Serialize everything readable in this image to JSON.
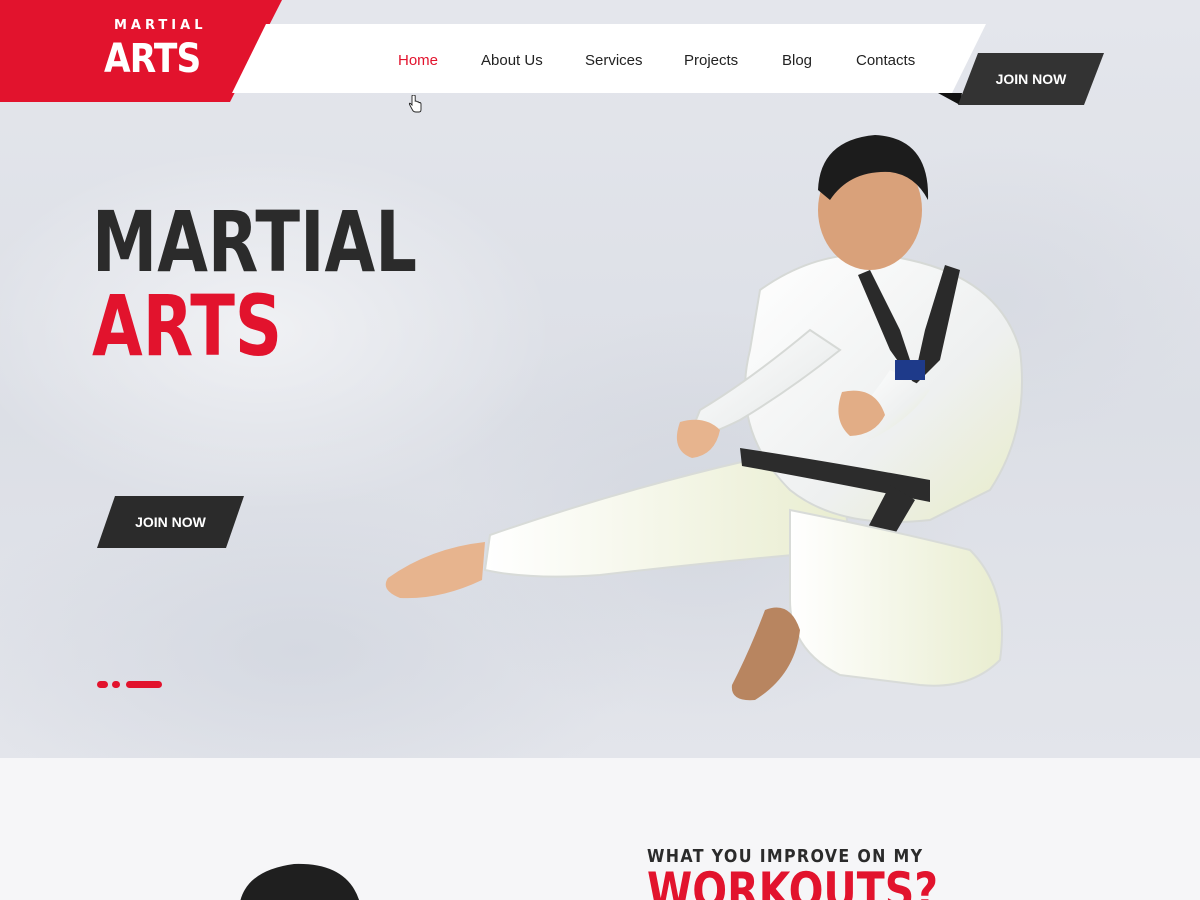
{
  "logo": {
    "top_text": "MARTIAL",
    "main_text": "ARTS"
  },
  "nav": {
    "items": [
      {
        "label": "Home",
        "active": true
      },
      {
        "label": "About Us",
        "active": false
      },
      {
        "label": "Services",
        "active": false
      },
      {
        "label": "Projects",
        "active": false
      },
      {
        "label": "Blog",
        "active": false
      },
      {
        "label": "Contacts",
        "active": false
      }
    ],
    "join_label": "JOIN NOW"
  },
  "hero": {
    "title_line1": "MARTIAL",
    "title_line2": "ARTS",
    "cta_label": "JOIN NOW",
    "slider": {
      "slides": 3,
      "active_slide": 3
    }
  },
  "section2": {
    "kicker": "WHAT YOU IMPROVE ON MY",
    "heading": "WORKOUTS?"
  },
  "colors": {
    "accent": "#e2132d",
    "dark": "#2b2b2b",
    "button": "#333333"
  }
}
